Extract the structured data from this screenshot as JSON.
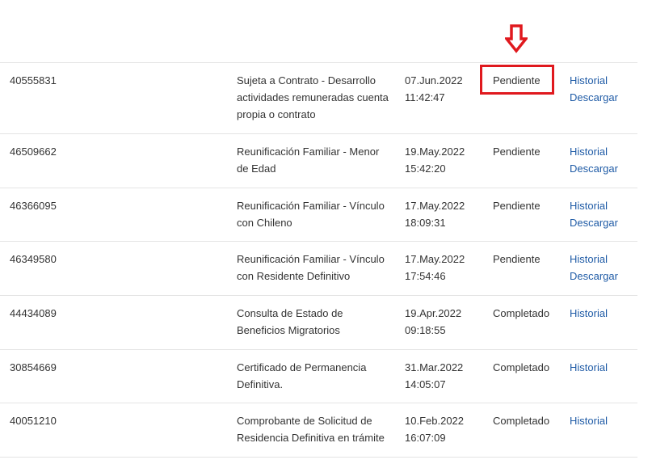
{
  "annotation": {
    "arrow_icon": "arrow-down-outline-icon",
    "arrow_color": "#e0191e",
    "highlight_color": "#e0191e"
  },
  "rows": [
    {
      "id": "40555831",
      "description": "Sujeta a Contrato - Desarrollo actividades remuneradas cuenta propia o contrato",
      "date": "07.Jun.2022",
      "time": "11:42:47",
      "status": "Pendiente",
      "links": [
        "Historial",
        "Descargar"
      ]
    },
    {
      "id": "46509662",
      "description": "Reunificación Familiar - Menor de Edad",
      "date": "19.May.2022",
      "time": "15:42:20",
      "status": "Pendiente",
      "links": [
        "Historial",
        "Descargar"
      ]
    },
    {
      "id": "46366095",
      "description": "Reunificación Familiar - Vínculo con Chileno",
      "date": "17.May.2022",
      "time": "18:09:31",
      "status": "Pendiente",
      "links": [
        "Historial",
        "Descargar"
      ]
    },
    {
      "id": "46349580",
      "description": "Reunificación Familiar - Vínculo con Residente Definitivo",
      "date": "17.May.2022",
      "time": "17:54:46",
      "status": "Pendiente",
      "links": [
        "Historial",
        "Descargar"
      ]
    },
    {
      "id": "44434089",
      "description": "Consulta de Estado de Beneficios Migratorios",
      "date": "19.Apr.2022",
      "time": "09:18:55",
      "status": "Completado",
      "links": [
        "Historial"
      ]
    },
    {
      "id": "30854669",
      "description": "Certificado de Permanencia Definitiva.",
      "date": "31.Mar.2022",
      "time": "14:05:07",
      "status": "Completado",
      "links": [
        "Historial"
      ]
    },
    {
      "id": "40051210",
      "description": "Comprobante de Solicitud de Residencia Definitiva en trámite",
      "date": "10.Feb.2022",
      "time": "16:07:09",
      "status": "Completado",
      "links": [
        "Historial"
      ]
    }
  ]
}
